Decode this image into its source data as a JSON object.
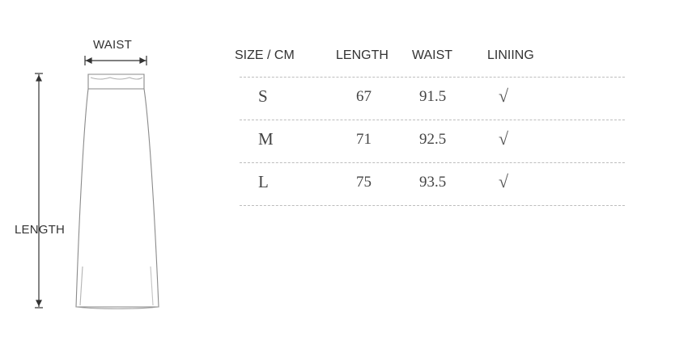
{
  "diagram": {
    "waist_label": "WAIST",
    "length_label": "LENGTH"
  },
  "table": {
    "headers": [
      "SIZE / CM",
      "LENGTH",
      "WAIST",
      "LINIING"
    ],
    "rows": [
      {
        "size": "S",
        "length": "67",
        "waist": "91.5",
        "lining": "√"
      },
      {
        "size": "M",
        "length": "71",
        "waist": "92.5",
        "lining": "√"
      },
      {
        "size": "L",
        "length": "75",
        "waist": "93.5",
        "lining": "√"
      }
    ]
  }
}
